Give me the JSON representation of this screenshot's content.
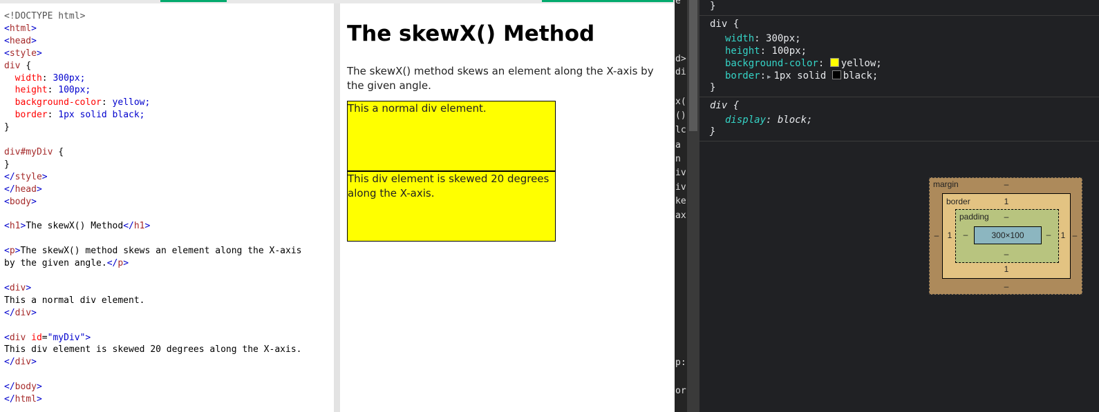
{
  "editor": {
    "lines": [
      "<!DOCTYPE html>",
      "<html>",
      "<head>",
      "<style>",
      "div {",
      "  width: 300px;",
      "  height: 100px;",
      "  background-color: yellow;",
      "  border: 1px solid black;",
      "}",
      "",
      "div#myDiv {",
      "}",
      "</style>",
      "</head>",
      "<body>",
      "",
      "<h1>The skewX() Method</h1>",
      "",
      "<p>The skewX() method skews an element along the X-axis",
      "by the given angle.</p>",
      "",
      "<div>",
      "This a normal div element.",
      "</div>",
      "",
      "<div id=\"myDiv\">",
      "This div element is skewed 20 degrees along the X-axis.",
      "</div>",
      "",
      "</body>",
      "</html>"
    ]
  },
  "result": {
    "heading": "The skewX() Method",
    "paragraph": "The skewX() method skews an element along the X-axis by the given angle.",
    "div1_text": "This a normal div element.",
    "div2_text": "This div element is skewed 20 degrees along the X-axis."
  },
  "gutter": [
    {
      "t": "e"
    },
    {
      "t": "d>"
    },
    {
      "t": "di"
    },
    {
      "t": "x("
    },
    {
      "t": "()"
    },
    {
      "t": "lc"
    },
    {
      "t": "a"
    },
    {
      "t": "n"
    },
    {
      "t": "iv"
    },
    {
      "t": "iv"
    },
    {
      "t": "ke"
    },
    {
      "t": "ax"
    },
    {
      "t": "p:"
    },
    {
      "t": "or"
    }
  ],
  "devtools": {
    "closing_brace": "}",
    "rule1": {
      "selector": "div {",
      "props": [
        {
          "name": "width",
          "value": "300px;"
        },
        {
          "name": "height",
          "value": "100px;"
        },
        {
          "name": "background-color",
          "value": "yellow;",
          "swatch": "#ffff00"
        },
        {
          "name": "border",
          "value": "1px solid ",
          "swatch": "#000000",
          "value2": "black;"
        }
      ],
      "end": "}"
    },
    "rule2": {
      "selector": "div {",
      "prop": "display",
      "value": "block;",
      "end": "}"
    },
    "colors": {
      "prop": "#35d4c7",
      "bg": "#202124"
    }
  },
  "box_model": {
    "margin_label": "margin",
    "border_label": "border",
    "padding_label": "padding",
    "content": "300×100",
    "margin": {
      "top": "–",
      "right": "–",
      "bottom": "–",
      "left": "–"
    },
    "border": {
      "top": "1",
      "right": "1",
      "bottom": "1",
      "left": "1"
    },
    "padding": {
      "top": "–",
      "right": "–",
      "bottom": "–",
      "left": "–"
    }
  }
}
